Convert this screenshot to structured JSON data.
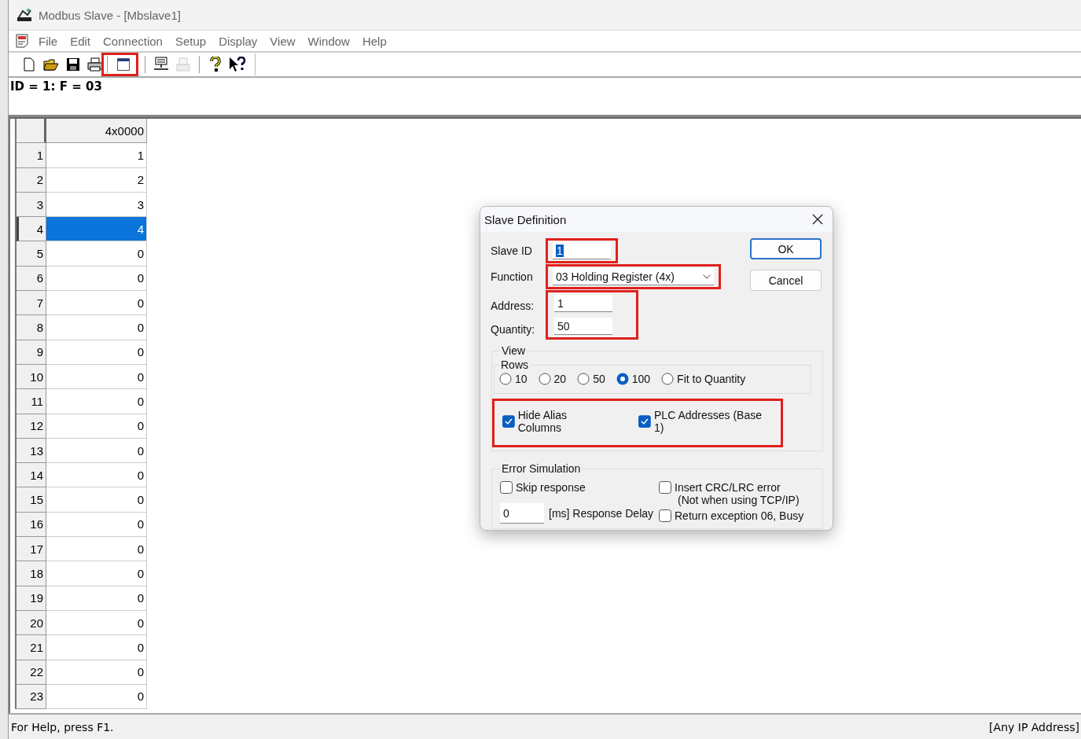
{
  "window": {
    "title": "Modbus Slave - [Mbslave1]"
  },
  "menu": [
    "File",
    "Edit",
    "Connection",
    "Setup",
    "Display",
    "View",
    "Window",
    "Help"
  ],
  "toolbar": [
    {
      "kind": "new",
      "disabled": false
    },
    {
      "kind": "open",
      "disabled": false
    },
    {
      "kind": "save",
      "disabled": false
    },
    {
      "kind": "print",
      "disabled": false
    },
    {
      "kind": "separator",
      "disabled": false
    },
    {
      "kind": "window",
      "disabled": false
    },
    {
      "kind": "separator",
      "disabled": false
    },
    {
      "kind": "connect",
      "disabled": false
    },
    {
      "kind": "disconnect",
      "disabled": true
    },
    {
      "kind": "separator",
      "disabled": false
    },
    {
      "kind": "help",
      "disabled": false
    },
    {
      "kind": "context-help",
      "disabled": false
    }
  ],
  "info_line": "ID = 1: F = 03",
  "grid": {
    "column": "4x0000",
    "rows": [
      {
        "number": "1",
        "value": "1",
        "selected": false
      },
      {
        "number": "2",
        "value": "2",
        "selected": false
      },
      {
        "number": "3",
        "value": "3",
        "selected": false
      },
      {
        "number": "4",
        "value": "4",
        "selected": true
      },
      {
        "number": "5",
        "value": "0",
        "selected": false
      },
      {
        "number": "6",
        "value": "0",
        "selected": false
      },
      {
        "number": "7",
        "value": "0",
        "selected": false
      },
      {
        "number": "8",
        "value": "0",
        "selected": false
      },
      {
        "number": "9",
        "value": "0",
        "selected": false
      },
      {
        "number": "10",
        "value": "0",
        "selected": false
      },
      {
        "number": "11",
        "value": "0",
        "selected": false
      },
      {
        "number": "12",
        "value": "0",
        "selected": false
      },
      {
        "number": "13",
        "value": "0",
        "selected": false
      },
      {
        "number": "14",
        "value": "0",
        "selected": false
      },
      {
        "number": "15",
        "value": "0",
        "selected": false
      },
      {
        "number": "16",
        "value": "0",
        "selected": false
      },
      {
        "number": "17",
        "value": "0",
        "selected": false
      },
      {
        "number": "18",
        "value": "0",
        "selected": false
      },
      {
        "number": "19",
        "value": "0",
        "selected": false
      },
      {
        "number": "20",
        "value": "0",
        "selected": false
      },
      {
        "number": "21",
        "value": "0",
        "selected": false
      },
      {
        "number": "22",
        "value": "0",
        "selected": false
      },
      {
        "number": "23",
        "value": "0",
        "selected": false
      }
    ]
  },
  "dialog": {
    "title": "Slave Definition",
    "fields": [
      {
        "kind": "text",
        "label": "Slave ID",
        "value": "1",
        "selected": true
      },
      {
        "kind": "select",
        "label": "Function",
        "value": "03 Holding Register (4x)",
        "selected": false
      },
      {
        "kind": "text",
        "label": "Address:",
        "value": "1",
        "selected": false
      },
      {
        "kind": "text",
        "label": "Quantity:",
        "value": "50",
        "selected": false
      }
    ],
    "buttons": [
      {
        "label": "OK",
        "default": true
      },
      {
        "label": "Cancel",
        "default": false
      }
    ],
    "view": {
      "title": "View",
      "rows_title": "Rows",
      "row_options": [
        {
          "label": "10",
          "selected": false
        },
        {
          "label": "20",
          "selected": false
        },
        {
          "label": "50",
          "selected": false
        },
        {
          "label": "100",
          "selected": true
        },
        {
          "label": "Fit to Quantity",
          "selected": false
        }
      ],
      "checkboxes": [
        {
          "label": "Hide Alias Columns",
          "checked": true
        },
        {
          "label": "PLC Addresses (Base 1)",
          "checked": true
        }
      ]
    },
    "error_simulation": {
      "title": "Error Simulation",
      "skip_response": {
        "label": "Skip response",
        "checked": false
      },
      "delay": {
        "value": "0",
        "label": "[ms] Response Delay"
      },
      "crc_error": {
        "label": "Insert CRC/LRC error",
        "note": "(Not when using TCP/IP)",
        "checked": false
      },
      "busy": {
        "label": "Return exception 06, Busy",
        "checked": false
      }
    }
  },
  "status_bar": {
    "help": "For Help, press F1.",
    "address": "[Any IP Address]"
  }
}
